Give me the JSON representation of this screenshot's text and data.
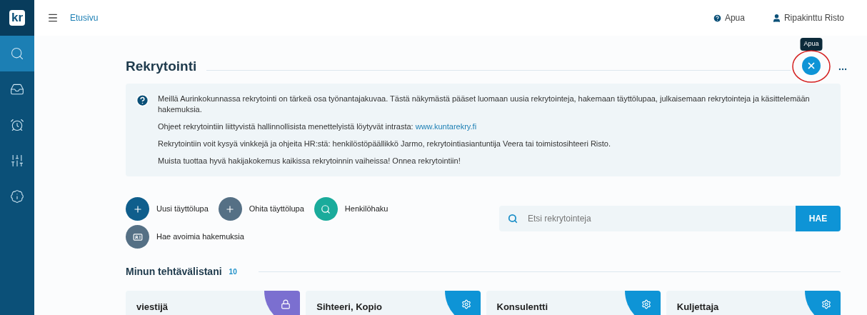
{
  "logo": "kr",
  "sidebar": {
    "items": [
      {
        "kind": "search",
        "selected": true
      },
      {
        "kind": "inbox",
        "selected": false
      },
      {
        "kind": "alarm",
        "selected": false
      },
      {
        "kind": "sliders",
        "selected": false
      },
      {
        "kind": "info",
        "selected": false
      }
    ]
  },
  "topbar": {
    "breadcrumb": "Etusivu",
    "help": "Apua",
    "user": "Ripakinttu Risto"
  },
  "page": {
    "title": "Rekrytointi",
    "tooltip": "Apua",
    "annotation_circle": true
  },
  "info": {
    "paragraphs": [
      "Meillä Aurinkokunnassa rekrytointi on tärkeä osa työnantajakuvaa. Tästä näkymästä pääset luomaan uusia rekrytointeja, hakemaan täyttölupaa, julkaisemaan rekrytointeja ja käsittelemään hakemuksia.",
      "Ohjeet rekrytointiin liittyvistä hallinnollisista menettelyistä löytyvät intrasta: ",
      "Rekrytointiin voit kysyä vinkkejä ja ohjeita HR:stä: henkilöstöpäällikkö Jarmo, rekrytointiasiantuntija Veera tai toimistosihteeri Risto.",
      "Muista tuottaa hyvä hakijakokemus kaikissa rekrytoinnin vaiheissa! Onnea rekrytointiin!"
    ],
    "link": "www.kuntarekry.fi"
  },
  "actions": [
    {
      "label": "Uusi täyttölupa",
      "kind": "plus",
      "color": "#0f5e8c"
    },
    {
      "label": "Ohita täyttölupa",
      "kind": "plus",
      "color": "#557085"
    },
    {
      "label": "Henkilöhaku",
      "kind": "search",
      "color": "#1aab9b"
    },
    {
      "label": "Hae avoimia hakemuksia",
      "kind": "card",
      "color": "#557085"
    }
  ],
  "search": {
    "placeholder": "Etsi rekrytointeja",
    "button": "HAE"
  },
  "tasks": {
    "title": "Minun tehtävälistani",
    "count": "10",
    "cards": [
      {
        "title": "viestijä",
        "kind": "lock",
        "color": "#7b6fd0"
      },
      {
        "title": "Sihteeri, Kopio",
        "kind": "gear",
        "color": "#0e94d6"
      },
      {
        "title": "Konsulentti",
        "kind": "gear",
        "color": "#0e94d6"
      },
      {
        "title": "Kuljettaja",
        "kind": "gear",
        "color": "#0e94d6"
      }
    ]
  }
}
